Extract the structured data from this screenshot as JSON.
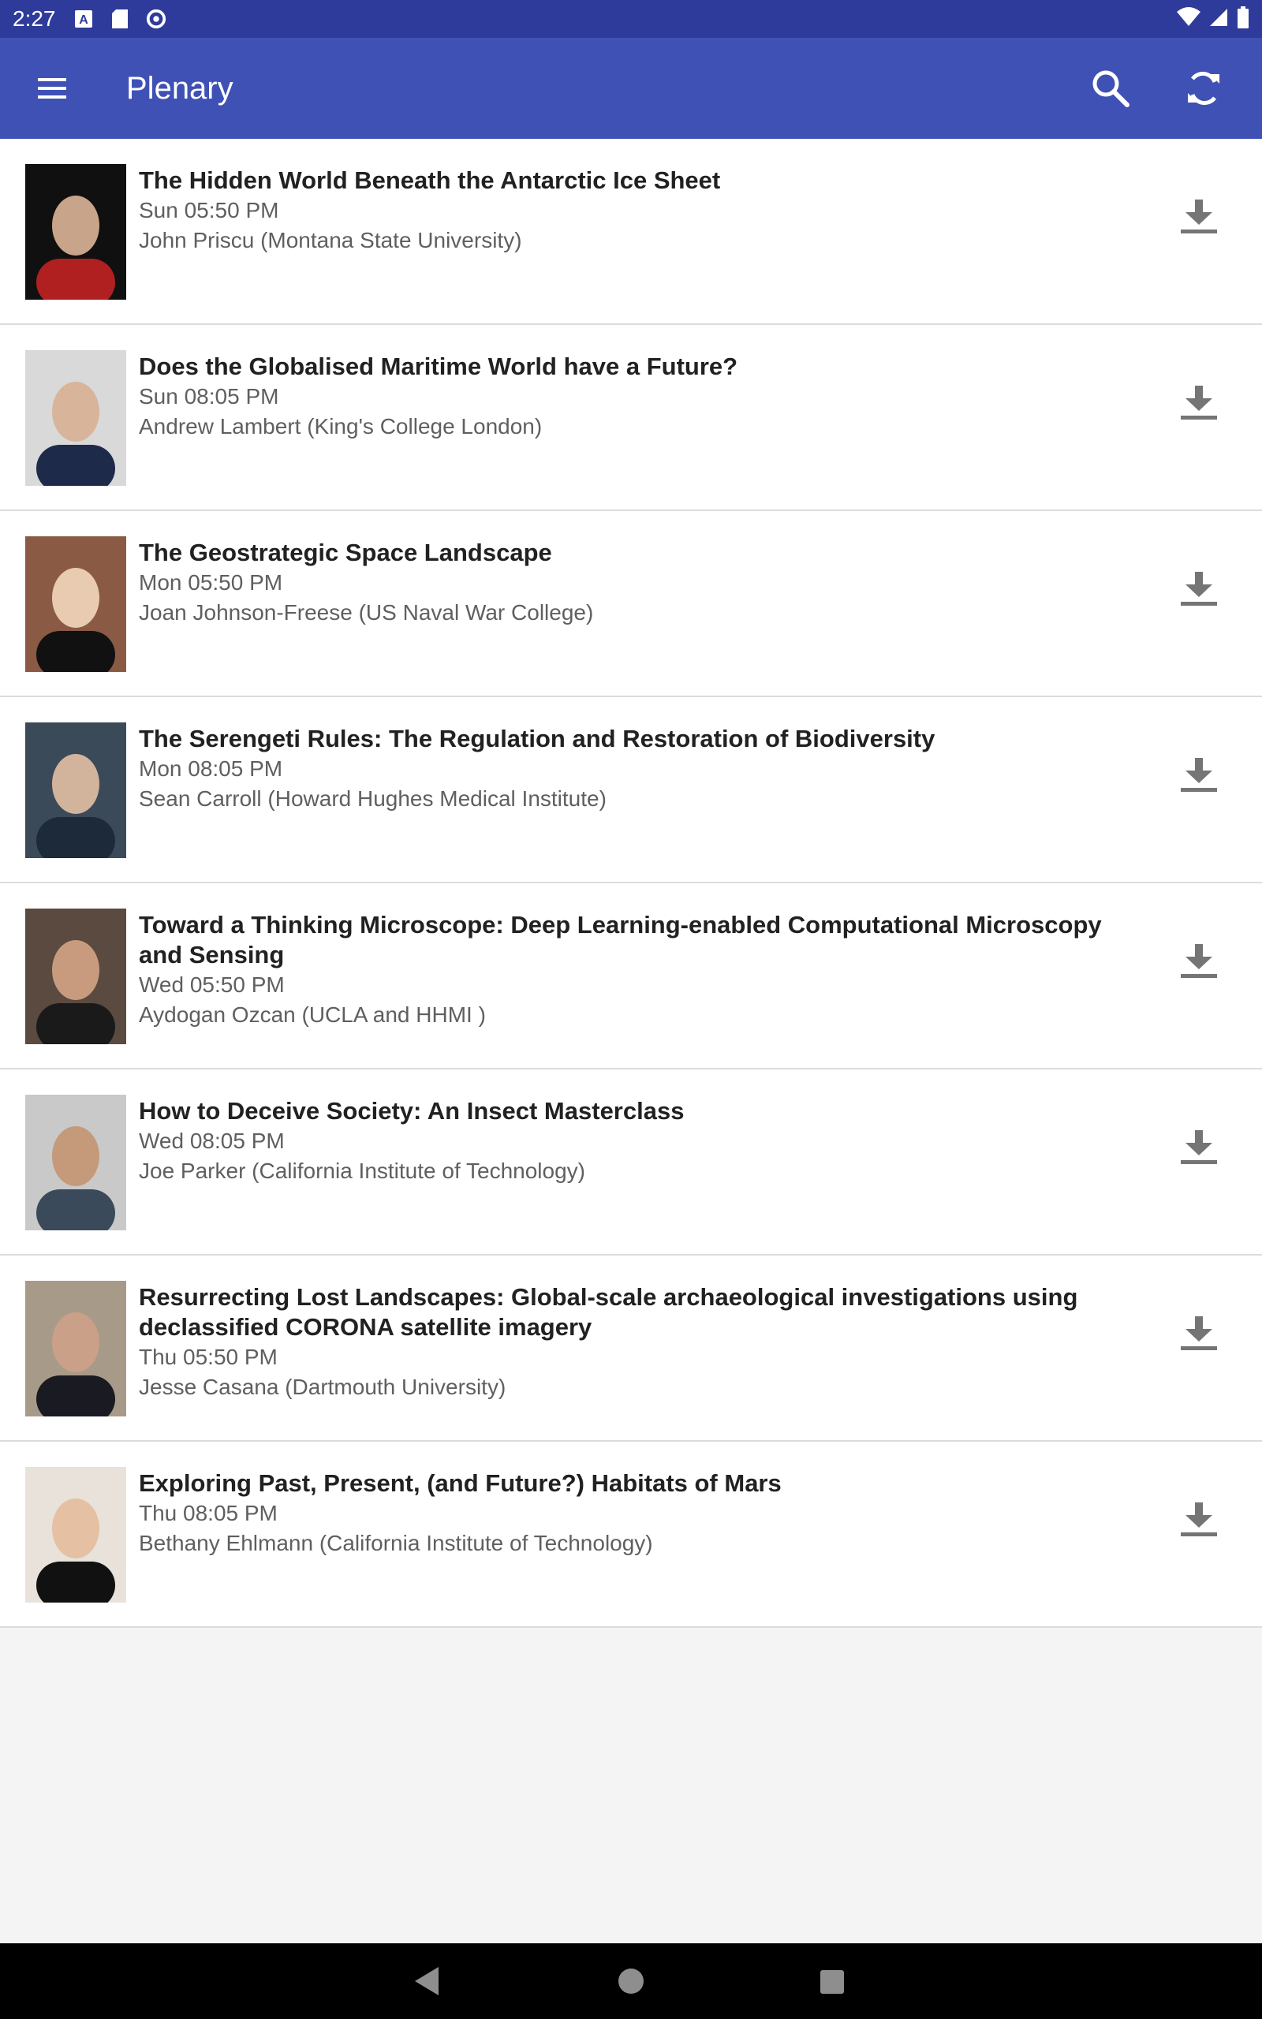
{
  "status_bar": {
    "time": "2:27",
    "icons_left": [
      "a-notification-icon",
      "sd-card-icon",
      "sync-status-icon"
    ],
    "icons_right": [
      "wifi-icon",
      "signal-icon",
      "battery-icon"
    ]
  },
  "app_bar": {
    "title": "Plenary",
    "menu_icon": "hamburger-menu-icon",
    "search_icon": "search-icon",
    "refresh_icon": "refresh-icon",
    "color": "#3f51b5",
    "status_color": "#2f3b9a"
  },
  "sessions": [
    {
      "title": "The Hidden World Beneath the Antarctic Ice Sheet",
      "time": "Sun 05:50 PM",
      "speaker": "John Priscu (Montana State University)",
      "photo_colors": [
        "#101010",
        "#c8a58a",
        "#b02020"
      ]
    },
    {
      "title": "Does the Globalised Maritime World have a Future?",
      "time": "Sun 08:05 PM",
      "speaker": "Andrew Lambert (King's College London)",
      "photo_colors": [
        "#d9d9d9",
        "#d8b49a",
        "#1e2a4a"
      ]
    },
    {
      "title": "The Geostrategic Space Landscape",
      "time": "Mon 05:50 PM",
      "speaker": "Joan Johnson-Freese (US Naval War College)",
      "photo_colors": [
        "#8a5a44",
        "#e8cbb0",
        "#111111"
      ]
    },
    {
      "title": "The Serengeti Rules: The Regulation and Restoration of Biodiversity",
      "time": "Mon 08:05 PM",
      "speaker": "Sean Carroll (Howard Hughes Medical Institute)",
      "photo_colors": [
        "#3a4a58",
        "#d2b39c",
        "#1d2a3a"
      ]
    },
    {
      "title": "Toward a Thinking Microscope: Deep Learning-enabled Computational Microscopy and Sensing",
      "time": "Wed 05:50 PM",
      "speaker": "Aydogan Ozcan (UCLA and HHMI )",
      "photo_colors": [
        "#5a4a40",
        "#c99b7e",
        "#1a1a1a"
      ]
    },
    {
      "title": "How to Deceive Society: An Insect Masterclass",
      "time": "Wed 08:05 PM",
      "speaker": "Joe Parker (California Institute of Technology)",
      "photo_colors": [
        "#c9c9c9",
        "#c49a7a",
        "#3a4a5a"
      ]
    },
    {
      "title": "Resurrecting Lost Landscapes: Global-scale archaeological investigations using declassified CORONA satellite imagery",
      "time": "Thu 05:50 PM",
      "speaker": "Jesse Casana (Dartmouth University)",
      "photo_colors": [
        "#a89a88",
        "#caa088",
        "#1a1a22"
      ]
    },
    {
      "title": "Exploring Past, Present, (and Future?) Habitats of Mars",
      "time": "Thu 08:05 PM",
      "speaker": "Bethany Ehlmann (California Institute of Technology)",
      "photo_colors": [
        "#e8e2da",
        "#e5c0a3",
        "#111111"
      ]
    }
  ],
  "download_icon": "download-icon",
  "nav_bar": {
    "back_icon": "back-triangle-icon",
    "home_icon": "home-circle-icon",
    "recent_icon": "recent-apps-square-icon"
  }
}
